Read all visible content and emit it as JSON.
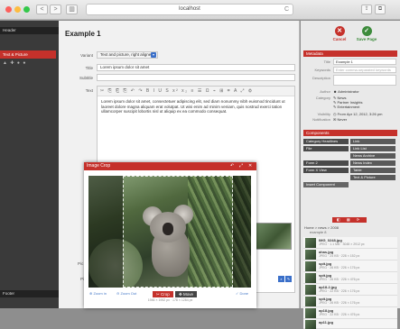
{
  "browser": {
    "url": "localhost",
    "back": "<",
    "forward": ">",
    "reload": "C",
    "sidebar_toggle": "▥",
    "share": "⇪",
    "tabs": "⧉"
  },
  "left_sidebar": {
    "header": "Header",
    "active_item": "Text & Picture",
    "icons": "▲ ✚ ● ●",
    "footer": "Footer"
  },
  "main": {
    "title": "Example 1",
    "fields": {
      "variant_label": "Variant",
      "variant_value": "Text and picture, right aligned",
      "title_label": "Title",
      "title_value": "Lorem ipsum dolor sit amet",
      "subtitle_label": "Subtitle",
      "subtitle_value": "",
      "text_label": "Text",
      "picture_label": "Pic",
      "picture_caption_label": "Pic\nCapt",
      "picture_link_label": "Picture"
    },
    "toolbar_glyphs": "✂ ⎘ ⎗ ⎘ ↶ ↷  B I U S x² x₂ ≡ ☰ Ω ⌁ ⊞ ⌗ A  ⤢ ⚙",
    "text_body": "Lorem ipsum dolor sit amet, consectetuer adipiscing elit, sed diam nonummy nibh euismod tincidunt ut laoreet dolore magna aliquam erat volutpat. Ut wisi enim ad minim veniam, quis nostrud exerci tation ullamcorper suscipit lobortis nisl ut aliquip ex ea commodo consequat.",
    "bottom_btns": [
      "⌕",
      "✎"
    ]
  },
  "right_panel": {
    "cancel_label": "Cancel",
    "save_label": "Save Page",
    "metadata": {
      "heading": "Metadata",
      "title_label": "Title",
      "title_value": "Example 1",
      "keywords_label": "Keywords",
      "keywords_placeholder": "Enter comma-separated keywords",
      "description_label": "Description",
      "description_value": "",
      "author_label": "Author",
      "author_value": "Administrator",
      "category_label": "Category",
      "category_values": [
        "News",
        "Partner Insights",
        "Entertainment"
      ],
      "visibility_label": "Visibility",
      "visibility_value": "From Apr 12, 2012, 3:26 pm",
      "notification_label": "Notification",
      "notification_value": "Never"
    },
    "components": {
      "heading": "Components",
      "left": [
        "Category Headlines",
        "File",
        "",
        "Form 2",
        "Form X View"
      ],
      "right": [
        "Link",
        "Link List",
        "News Archive",
        "News Index",
        "Table",
        "Text & Picture"
      ],
      "insert": "Insert Component"
    },
    "library": {
      "tabs": "◧ ▦ ⟳",
      "path": "Home > news > 2008",
      "count": "example 8",
      "items": [
        {
          "name": "IMG_0248.jpg",
          "meta": "JPEG · 1.1 MB · 3048 × 2912 px"
        },
        {
          "name": "ahas.jpg",
          "meta": "JPEG · 24 KB · 228 × 152 px"
        },
        {
          "name": "spit.jpg",
          "meta": "JPEG · 26 KB · 226 × 176 px"
        },
        {
          "name": "spit.jpg",
          "meta": "JPEG · 26 KB · 226 × 476 px"
        },
        {
          "name": "ap18-2.jpg",
          "meta": "JPEG · 22 KB · 226 × 176 px"
        },
        {
          "name": "spit.jpg",
          "meta": "JPEG · 26 KB · 226 × 176 px"
        },
        {
          "name": "ap18.jpg",
          "meta": "JPEG · 22 KB · 226 × 476 px"
        },
        {
          "name": "ap11.jpg",
          "meta": "JPEG · 22 KB · 226 × 476 px"
        }
      ]
    }
  },
  "modal": {
    "title": "Image Crop",
    "controls": [
      "↶",
      "⤢",
      "✕"
    ],
    "zoom_in": "Zoom in",
    "zoom_out": "Zoom Out",
    "crop": "Crop",
    "move": "Move",
    "done": "Done",
    "size_info": "1946 × 1952 px  ·  178 × 1284 px"
  },
  "colors": {
    "accent": "#c5312b",
    "dark": "#3a3a3a",
    "link": "#3a6fc9",
    "save_green": "#3c8b3b"
  }
}
